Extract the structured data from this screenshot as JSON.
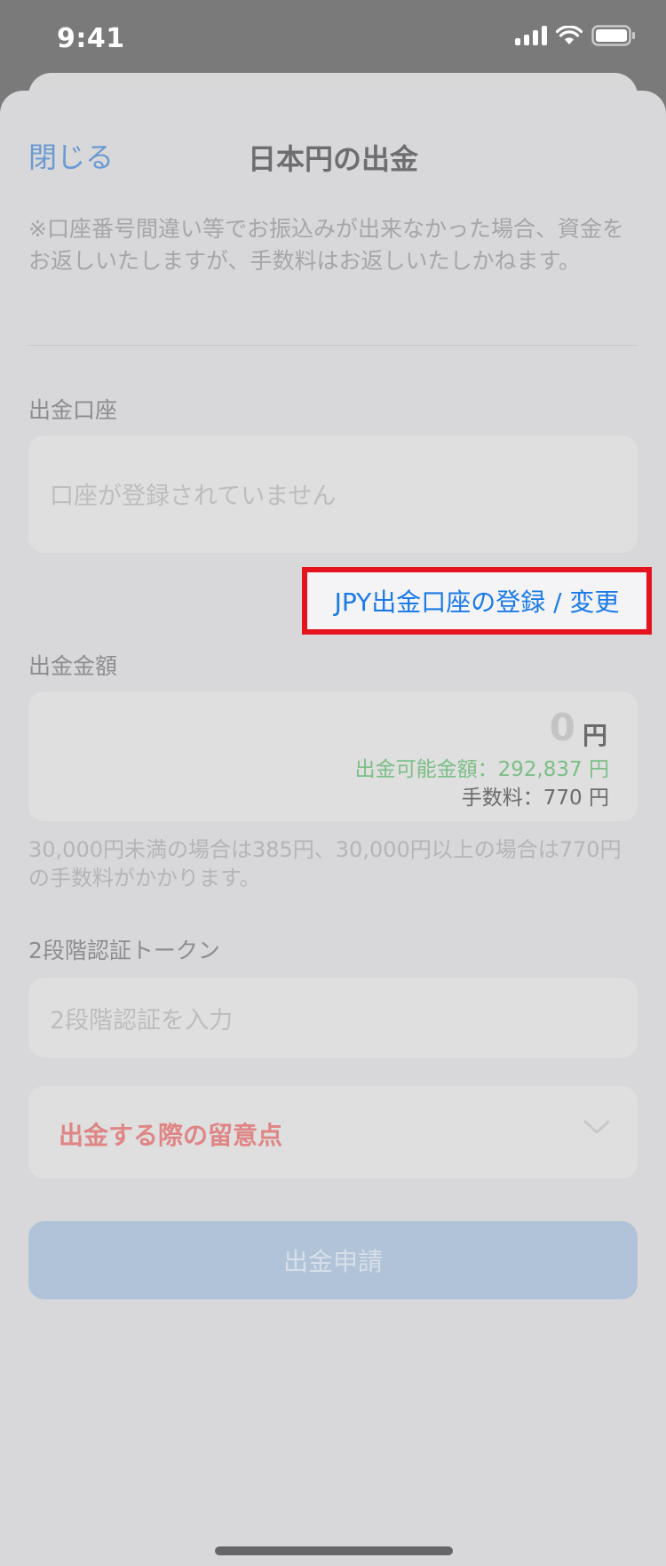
{
  "status_bar": {
    "time": "9:41"
  },
  "header": {
    "close_label": "閉じる",
    "title": "日本円の出金"
  },
  "notice": "※口座番号間違い等でお振込みが出来なかった場合、資金をお返しいたしますが、手数料はお返しいたしかねます。",
  "account": {
    "label": "出金口座",
    "placeholder": "口座が登録されていません",
    "link_label": "JPY出金口座の登録 / 変更"
  },
  "amount": {
    "label": "出金金額",
    "value": "0",
    "unit": "円",
    "available_label": "出金可能金額：292,837 円",
    "fee_label": "手数料：770 円",
    "fee_note": "30,000円未満の場合は385円、30,000円以上の場合は770円の手数料がかかります。"
  },
  "token": {
    "label": "2段階認証トークン",
    "placeholder": "2段階認証を入力"
  },
  "notes": {
    "label": "出金する際の留意点"
  },
  "submit_label": "出金申請",
  "colors": {
    "link": "#1a7ae8",
    "highlight_border": "#e5131d",
    "available": "#7bbf86",
    "notes": "#df8585",
    "submit_bg": "#b0c3d8"
  }
}
